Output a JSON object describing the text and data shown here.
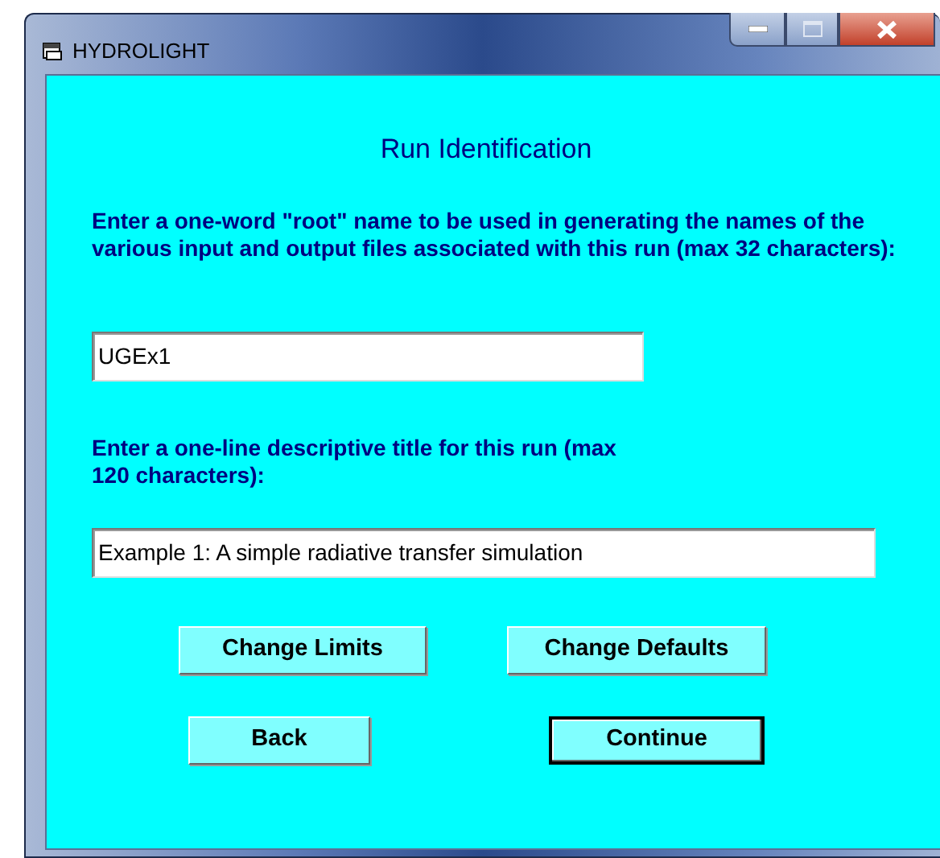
{
  "window": {
    "title": "HYDROLIGHT"
  },
  "heading": "Run Identification",
  "fields": [
    {
      "label": "Enter a one-word \"root\" name to be used in generating the names of the various input and output files associated with this run (max 32 characters):",
      "value": "UGEx1"
    },
    {
      "label": "Enter a one-line descriptive title for this run (max 120 characters):",
      "value": "Example 1: A simple radiative transfer simulation"
    }
  ],
  "buttons": [
    {
      "label": "Change Limits",
      "default": false
    },
    {
      "label": "Change Defaults",
      "default": false
    },
    {
      "label": "Back",
      "default": false
    },
    {
      "label": "Continue",
      "default": true
    }
  ]
}
